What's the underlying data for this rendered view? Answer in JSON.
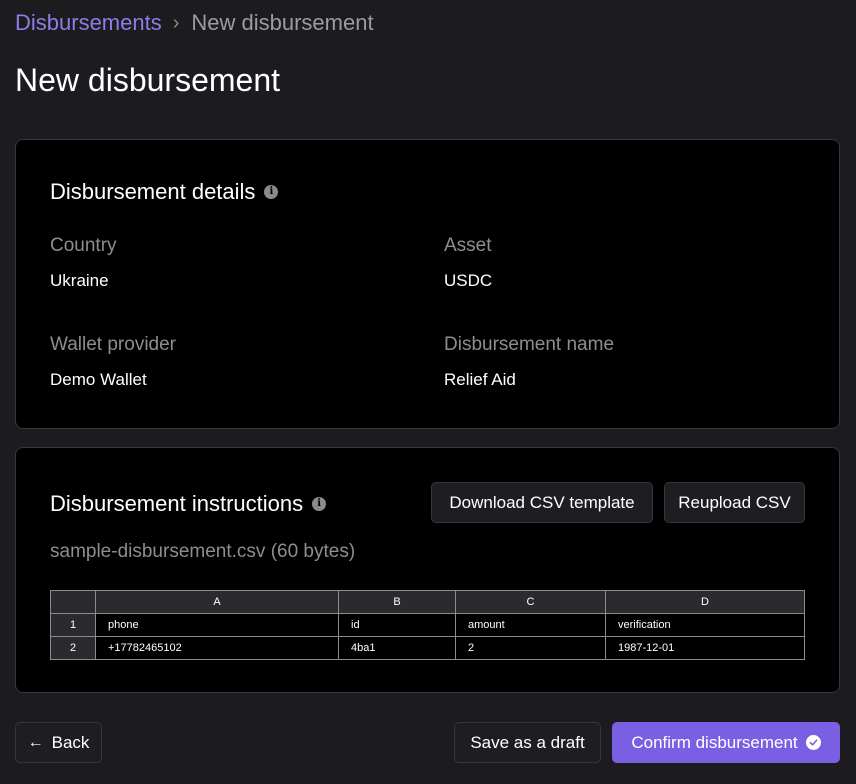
{
  "breadcrumb": {
    "parent": "Disbursements",
    "separator": "›",
    "current": "New disbursement"
  },
  "page_title": "New disbursement",
  "details": {
    "heading": "Disbursement details",
    "info_icon": "info-icon",
    "fields": {
      "country": {
        "label": "Country",
        "value": "Ukraine"
      },
      "asset": {
        "label": "Asset",
        "value": "USDC"
      },
      "wallet_provider": {
        "label": "Wallet provider",
        "value": "Demo Wallet"
      },
      "disbursement_name": {
        "label": "Disbursement name",
        "value": "Relief Aid"
      }
    }
  },
  "instructions": {
    "heading": "Disbursement instructions",
    "download_label": "Download CSV template",
    "reupload_label": "Reupload CSV",
    "file_info": "sample-disbursement.csv (60 bytes)",
    "table": {
      "columns": [
        "A",
        "B",
        "C",
        "D"
      ],
      "rows": [
        {
          "num": "1",
          "cells": [
            "phone",
            "id",
            "amount",
            "verification"
          ]
        },
        {
          "num": "2",
          "cells": [
            "+17782465102",
            "4ba1",
            "2",
            "1987-12-01"
          ]
        }
      ]
    }
  },
  "footer": {
    "back_label": "Back",
    "draft_label": "Save as a draft",
    "confirm_label": "Confirm disbursement"
  },
  "colors": {
    "accent": "#7a5fe3",
    "link": "#8e7ce8",
    "background": "#1c1b1f",
    "card": "#000000"
  }
}
